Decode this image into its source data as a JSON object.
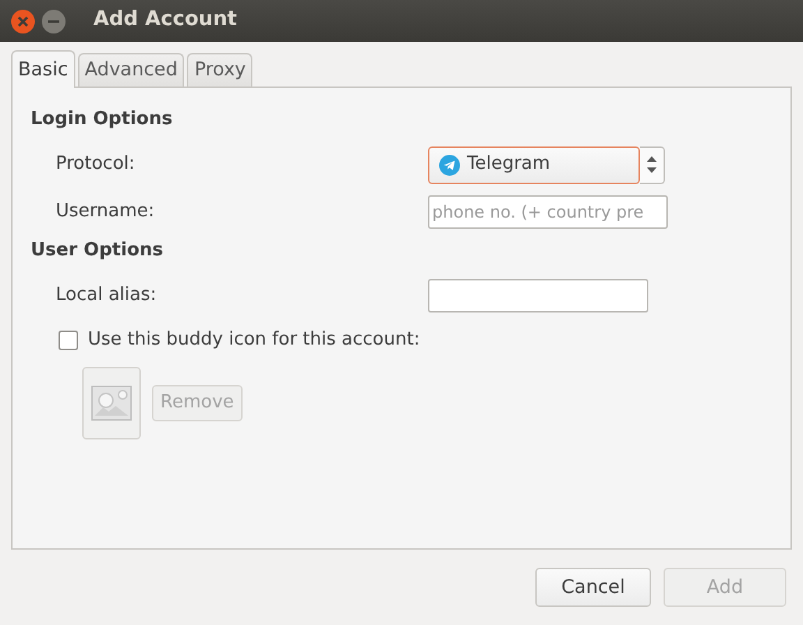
{
  "window": {
    "title": "Add Account"
  },
  "tabs": [
    {
      "label": "Basic",
      "selected": true
    },
    {
      "label": "Advanced",
      "selected": false
    },
    {
      "label": "Proxy",
      "selected": false
    }
  ],
  "sections": [
    {
      "heading": "Login Options",
      "rows": [
        {
          "kind": "combo",
          "label": "Protocol:",
          "value": "Telegram"
        },
        {
          "kind": "text",
          "label": "Username:",
          "placeholder": "phone no. (+ country pre"
        }
      ]
    },
    {
      "heading": "User Options",
      "rows": [
        {
          "kind": "text",
          "label": "Local alias:",
          "value": ""
        },
        {
          "kind": "check",
          "label": "Use this buddy icon for this account:",
          "checked": false
        },
        {
          "kind": "buddy",
          "remove": {
            "label": "Remove",
            "disabled": true
          }
        }
      ]
    }
  ],
  "buttons": [
    {
      "label": "Cancel",
      "disabled": false
    },
    {
      "label": "Add",
      "disabled": true
    }
  ]
}
